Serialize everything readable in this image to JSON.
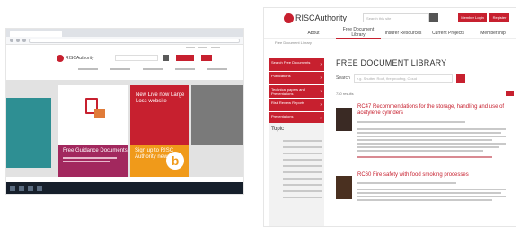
{
  "left_screenshot": {
    "site_logo": "RISCAuthority",
    "tile_red_text": "New Live now Large Loss website",
    "tile_purple_title": "Free Guidance Documents",
    "tile_orange_text": "Sign up to RISC Authority newsletter",
    "orange_badge": "b",
    "hero_tile_colors": {
      "teal": "#2e8f93",
      "red": "#c7202f",
      "purple": "#a2285e",
      "orange": "#f09a1a"
    }
  },
  "right_screenshot": {
    "logo": "RISCAuthority",
    "search_placeholder": "Search this site",
    "member_login": "Member Login",
    "register": "Register",
    "nav": [
      "About",
      "Free Document Library",
      "Insurer Resources",
      "Current Projects",
      "Membership"
    ],
    "breadcrumb": "Free Document Library",
    "sidebar": [
      "Search Free Documents",
      "Publications",
      "Technical papers and Presentations",
      "Risk Review Reports",
      "Presentations"
    ],
    "topics_heading": "Topic",
    "page_title": "FREE DOCUMENT LIBRARY",
    "search_label": "Search",
    "search_field_placeholder": "e.g. Shutter, Roof, fire proofing, Cloud",
    "result_count": "730 results",
    "docs": [
      {
        "title": "RC47 Recommendations for the storage, handling and use of acetylene cylinders"
      },
      {
        "title": "RC60 Fire safety with food smoking processes"
      }
    ]
  }
}
